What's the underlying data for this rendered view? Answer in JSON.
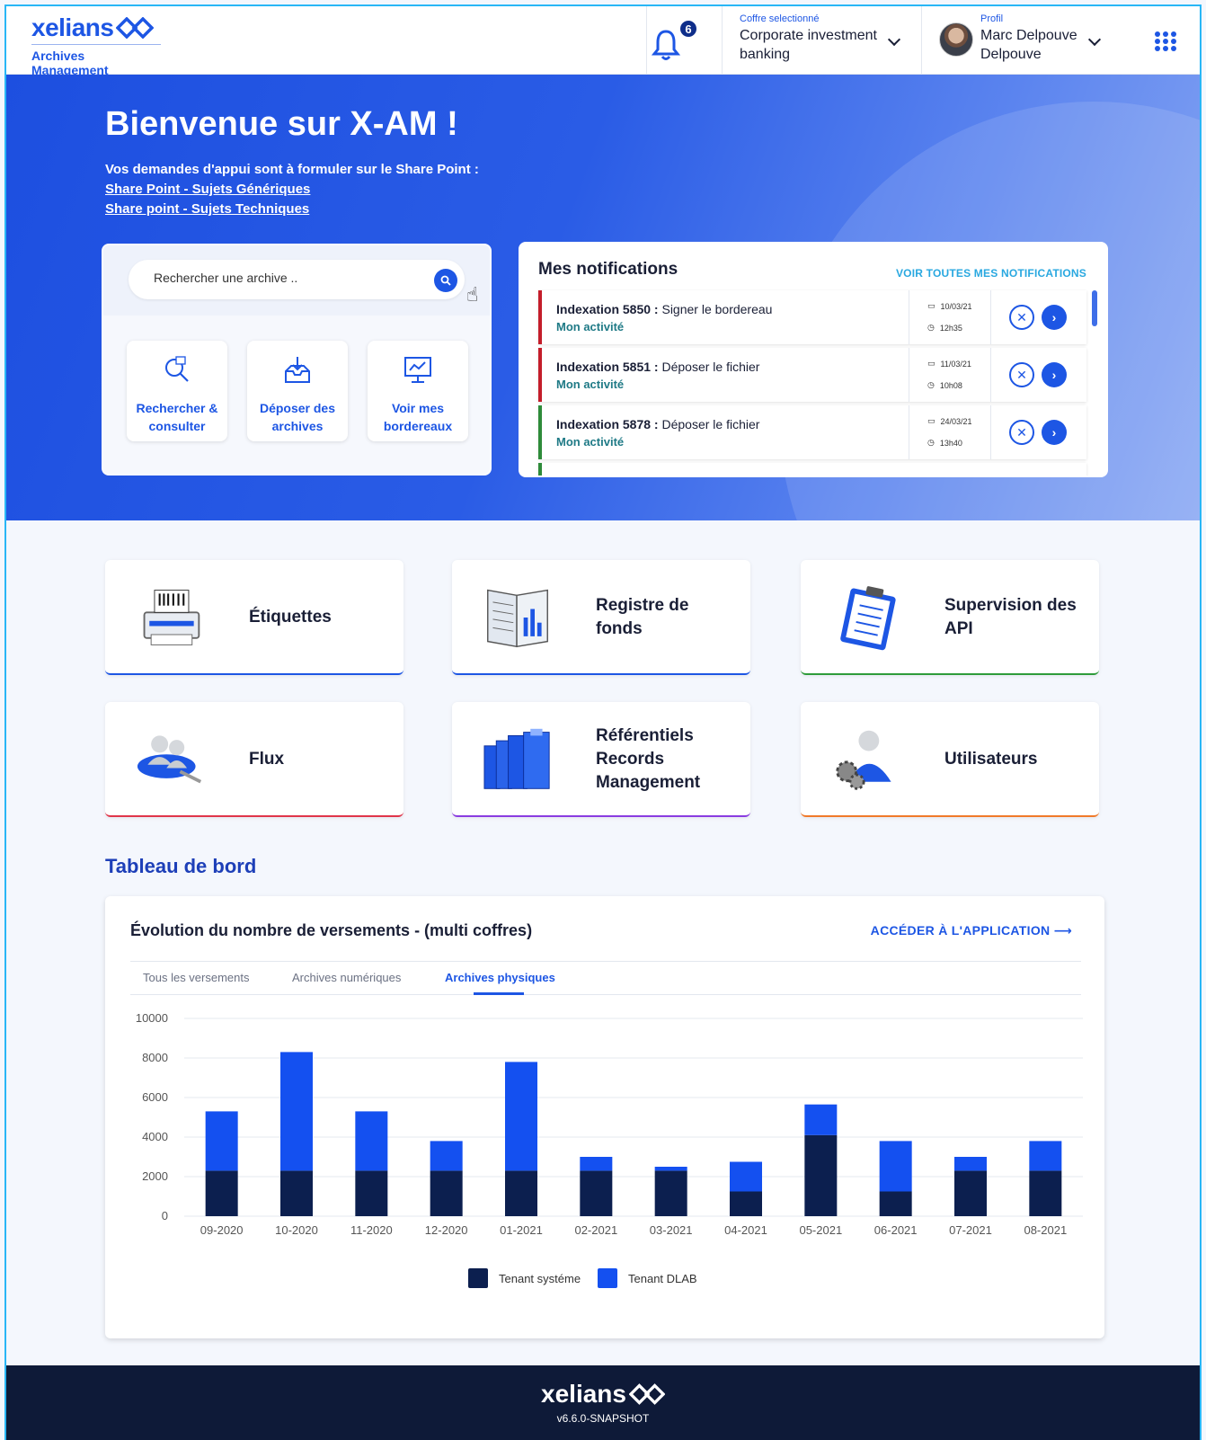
{
  "header": {
    "logo_text": "xelians",
    "logo_sub": "Archives Management",
    "notifications_count": "6",
    "vault_label": "Coffre selectionné",
    "vault_value_1": "Corporate investment",
    "vault_value_2": "banking",
    "profile_label": "Profil",
    "profile_name_1": "Marc Delpouve",
    "profile_name_2": "Delpouve"
  },
  "hero": {
    "title": "Bienvenue sur X-AM !",
    "support_text": "Vos demandes d'appui sont à formuler sur le Share Point :",
    "link_1": "Share Point - Sujets Génériques",
    "link_2": "Share point - Sujets Techniques"
  },
  "search": {
    "placeholder": "Rechercher une archive .."
  },
  "quick_actions": [
    {
      "line1": "Rechercher &",
      "line2": "consulter"
    },
    {
      "line1": "Déposer des",
      "line2": "archives"
    },
    {
      "line1": "Voir mes",
      "line2": "bordereaux"
    }
  ],
  "notifications": {
    "title": "Mes notifications",
    "see_all": "VOIR TOUTES MES NOTIFICATIONS",
    "items": [
      {
        "id": "Indexation 5850 :",
        "action": "Signer le bordereau",
        "sub": "Mon activité",
        "date": "10/03/21",
        "time": "12h35",
        "status_color": "#c41d2a"
      },
      {
        "id": "Indexation 5851 :",
        "action": "Déposer le fichier",
        "sub": "Mon activité",
        "date": "11/03/21",
        "time": "10h08",
        "status_color": "#c41d2a"
      },
      {
        "id": "Indexation 5878 :",
        "action": "Déposer le fichier",
        "sub": "Mon activité",
        "date": "24/03/21",
        "time": "13h40",
        "status_color": "#2e8b3a"
      }
    ]
  },
  "tiles": [
    {
      "label": "Étiquettes",
      "accent": "#1d56e4",
      "icon": "label-printer-icon"
    },
    {
      "label": "Registre de fonds",
      "accent": "#1d56e4",
      "icon": "register-book-icon"
    },
    {
      "label": "Supervision des API",
      "accent": "#2e9b3a",
      "icon": "clipboard-icon"
    },
    {
      "label": "Flux",
      "accent": "#e0354a",
      "icon": "users-flow-icon"
    },
    {
      "label": "Référentiels Records Management",
      "accent": "#8a3ce0",
      "icon": "folders-icon"
    },
    {
      "label": "Utilisateurs",
      "accent": "#f07a2a",
      "icon": "user-gears-icon"
    }
  ],
  "dashboard": {
    "title": "Tableau de bord",
    "chart_title": "Évolution du nombre de versements - (multi coffres)",
    "app_link": "ACCÉDER À L'APPLICATION",
    "tabs": [
      "Tous les versements",
      "Archives numériques",
      "Archives physiques"
    ],
    "active_tab": "Archives physiques"
  },
  "chart_data": {
    "type": "bar",
    "stacked": true,
    "categories": [
      "09-2020",
      "10-2020",
      "11-2020",
      "12-2020",
      "01-2021",
      "02-2021",
      "03-2021",
      "04-2021",
      "05-2021",
      "06-2021",
      "07-2021",
      "08-2021"
    ],
    "series": [
      {
        "name": "Tenant systéme",
        "color": "#0c1f4f",
        "values": [
          2300,
          2300,
          2300,
          2300,
          2300,
          2300,
          2300,
          1250,
          4100,
          1250,
          2300,
          2300
        ]
      },
      {
        "name": "Tenant DLAB",
        "color": "#1450f0",
        "values": [
          3000,
          6000,
          3000,
          1500,
          5500,
          700,
          200,
          1500,
          1550,
          2550,
          700,
          1500
        ]
      }
    ],
    "ylim": [
      0,
      10000
    ],
    "yticks": [
      0,
      2000,
      4000,
      6000,
      8000,
      10000
    ],
    "grid": true,
    "legend": "bottom"
  },
  "footer": {
    "logo_text": "xelians",
    "version": "v6.6.0-SNAPSHOT"
  }
}
